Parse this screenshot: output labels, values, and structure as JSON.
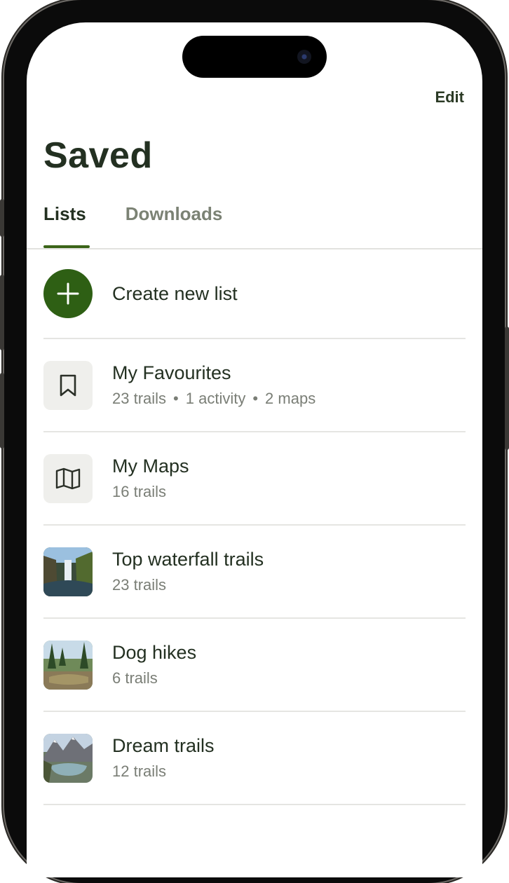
{
  "header": {
    "edit_label": "Edit",
    "title": "Saved"
  },
  "tabs": [
    {
      "label": "Lists",
      "active": true
    },
    {
      "label": "Downloads",
      "active": false
    }
  ],
  "create": {
    "label": "Create new list"
  },
  "lists": [
    {
      "name": "My Favourites",
      "meta": [
        "23 trails",
        "1 activity",
        "2 maps"
      ],
      "icon": "bookmark-icon"
    },
    {
      "name": "My Maps",
      "meta": [
        "16 trails"
      ],
      "icon": "map-icon"
    },
    {
      "name": "Top waterfall trails",
      "meta": [
        "23 trails"
      ],
      "icon": "waterfall-photo"
    },
    {
      "name": "Dog hikes",
      "meta": [
        "6 trails"
      ],
      "icon": "forest-creek-photo"
    },
    {
      "name": "Dream trails",
      "meta": [
        "12 trails"
      ],
      "icon": "mountain-lake-photo"
    }
  ],
  "colors": {
    "accent": "#2e5f14",
    "text": "#233021",
    "muted": "#7a7e76"
  }
}
